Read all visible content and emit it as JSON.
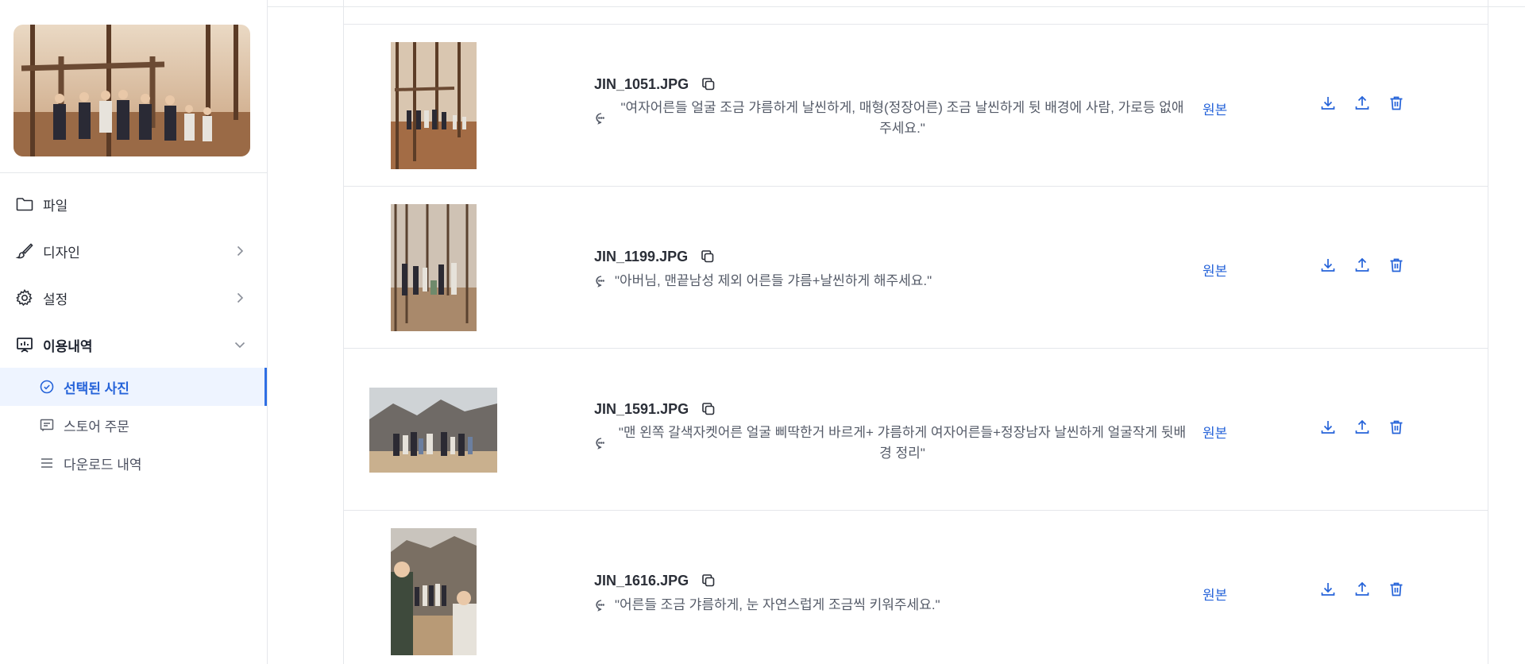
{
  "sidebar": {
    "nav": [
      {
        "label": "파일",
        "icon": "folder-icon",
        "has_chevron": false
      },
      {
        "label": "디자인",
        "icon": "brush-icon",
        "has_chevron": true
      },
      {
        "label": "설정",
        "icon": "gear-icon",
        "has_chevron": true
      },
      {
        "label": "이용내역",
        "icon": "presentation-chart-icon",
        "has_chevron": true,
        "expanded": true
      }
    ],
    "sub": [
      {
        "label": "선택된 사진",
        "icon": "check-circle-icon",
        "active": true
      },
      {
        "label": "스토어 주문",
        "icon": "receipt-icon",
        "active": false
      },
      {
        "label": "다운로드 내역",
        "icon": "list-icon",
        "active": false
      }
    ]
  },
  "rows": [
    {
      "filename": "JIN_1051.JPG",
      "memo": "\"여자어른들 얼굴 조금 갸름하게 날씬하게, 매형(정장어른) 조금 날씬하게 뒷 배경에 사람, 가로등 없애주세요.\"",
      "origin_label": "원본",
      "orientation": "portrait"
    },
    {
      "filename": "JIN_1199.JPG",
      "memo": "\"아버님, 맨끝남성 제외 어른들 갸름+날씬하게 해주세요.\"",
      "origin_label": "원본",
      "orientation": "portrait"
    },
    {
      "filename": "JIN_1591.JPG",
      "memo": "\"맨 왼쪽 갈색자켓어른 얼굴 삐딱한거 바르게+ 갸름하게 여자어른들+정장남자 날씬하게 얼굴작게 뒷배경 정리\"",
      "origin_label": "원본",
      "orientation": "landscape"
    },
    {
      "filename": "JIN_1616.JPG",
      "memo": "\"어른들 조금 갸름하게, 눈 자연스럽게 조금씩 키워주세요.\"",
      "origin_label": "원본",
      "orientation": "portrait"
    }
  ],
  "row_action_icons": [
    "download-icon",
    "upload-icon",
    "trash-icon"
  ],
  "colors": {
    "accent": "#2563d9",
    "active_bg": "#eef4ff",
    "border": "#e5e7eb"
  }
}
